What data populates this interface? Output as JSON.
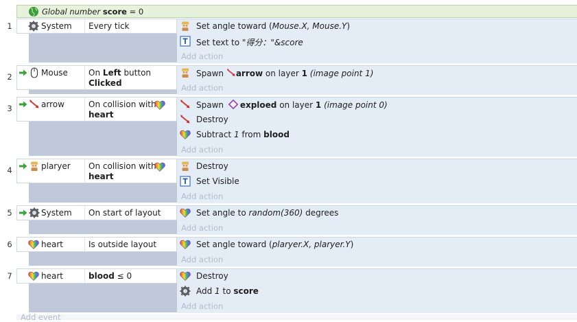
{
  "colors": {
    "global_bg": "#e6f2dc",
    "condition_bg": "#c0c9d9",
    "action_bg": "#e4ecf6",
    "add_action_text": "#b3bccb"
  },
  "global_variable": {
    "prefix": "Global number",
    "name": "score",
    "suffix": "= 0",
    "icon": "globe-icon"
  },
  "events": [
    {
      "number": "1",
      "object": "System",
      "object_icon": "gear-icon",
      "condition": "Every tick",
      "actions": [
        {
          "icon": "character-icon",
          "parts": [
            "Set angle toward (",
            "Mouse.X, Mouse.Y",
            ")"
          ]
        },
        {
          "icon": "text-object-icon",
          "parts": [
            "Set text to ",
            "\"得分：\"&score",
            ""
          ]
        }
      ],
      "add_action": "Add action"
    },
    {
      "number": "2",
      "object": "Mouse",
      "object_icon": "mouse-icon",
      "condition_parts": [
        "On ",
        "Left",
        " button",
        "Clicked"
      ],
      "actions": [
        {
          "icon": "character-icon",
          "parts": [
            "Spawn ",
            "arrow",
            " on layer ",
            "1",
            " ",
            "(image point 1)"
          ]
        }
      ],
      "add_action": "Add action"
    },
    {
      "number": "3",
      "object": "arrow",
      "object_icon": "arrow-sprite-icon",
      "condition_parts": [
        "On collision with",
        "heart"
      ],
      "actions": [
        {
          "icon": "arrow-sprite-icon",
          "parts": [
            "Spawn ",
            "exploed",
            " on layer ",
            "1",
            " ",
            "(image point 0)"
          ]
        },
        {
          "icon": "arrow-sprite-icon",
          "parts": [
            "Destroy"
          ]
        },
        {
          "icon": "heart-icon",
          "parts": [
            "Subtract ",
            "1",
            " from ",
            "blood"
          ]
        }
      ],
      "add_action": "Add action"
    },
    {
      "number": "4",
      "object": "plaryer",
      "object_icon": "character-icon",
      "condition_parts": [
        "On collision with",
        "heart"
      ],
      "actions": [
        {
          "icon": "character-icon",
          "parts": [
            "Destroy"
          ]
        },
        {
          "icon": "text-object-icon",
          "parts": [
            "Set Visible"
          ]
        }
      ],
      "add_action": "Add action"
    },
    {
      "number": "5",
      "object": "System",
      "object_icon": "gear-icon",
      "condition": "On start of layout",
      "actions": [
        {
          "icon": "heart-icon",
          "parts": [
            "Set angle to ",
            "random(360)",
            "  degrees"
          ]
        }
      ],
      "add_action": "Add action"
    },
    {
      "number": "6",
      "object": "heart",
      "object_icon": "heart-icon",
      "condition": "Is outside layout",
      "actions": [
        {
          "icon": "heart-icon",
          "parts": [
            "Set angle toward (",
            "plaryer.X, plaryer.Y",
            ")"
          ]
        }
      ],
      "add_action": "Add action"
    },
    {
      "number": "7",
      "object": "heart",
      "object_icon": "heart-icon",
      "condition_parts": [
        "blood",
        " ≤ 0"
      ],
      "actions": [
        {
          "icon": "heart-icon",
          "parts": [
            "Destroy"
          ]
        },
        {
          "icon": "gear-icon",
          "parts": [
            "Add ",
            "1",
            " to ",
            "score"
          ]
        }
      ],
      "add_action": "Add action"
    }
  ],
  "add_event": "Add event"
}
